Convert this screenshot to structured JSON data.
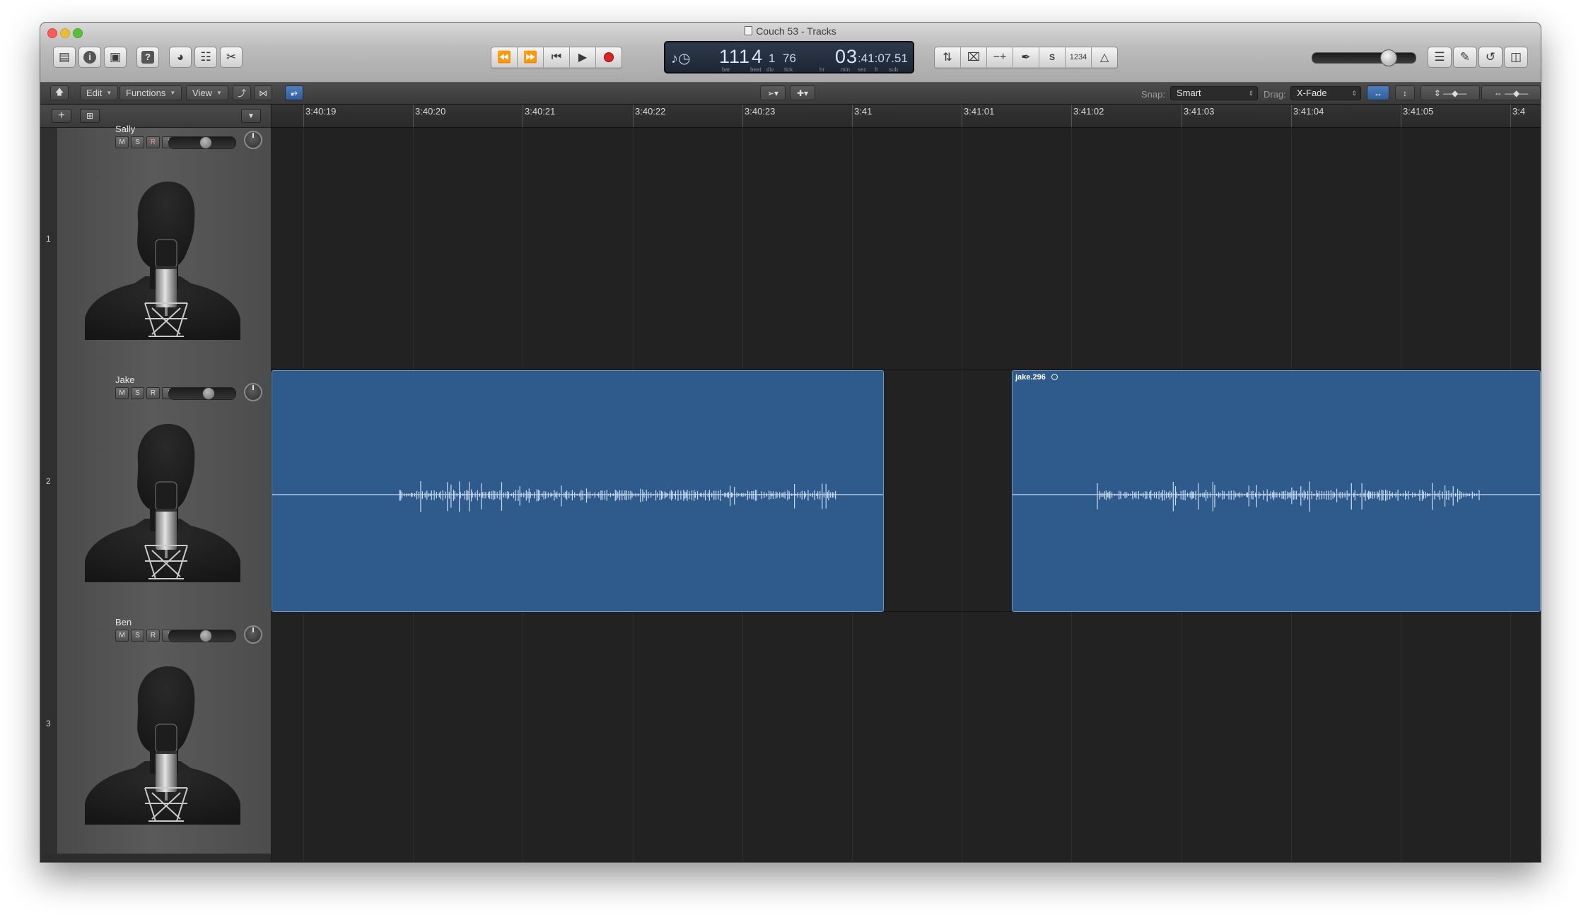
{
  "window": {
    "title": "Couch 53 - Tracks"
  },
  "lcd": {
    "bar": "111",
    "beat": "4",
    "div": "1",
    "tick": "76",
    "time_hr": "03",
    "time_rest": ":41:07.51",
    "labels": [
      "bar",
      "beat",
      "div",
      "tick",
      "hr",
      "min",
      "sec",
      "fr",
      "sub"
    ]
  },
  "toolbar": {
    "catch_label": "1234"
  },
  "control_bar": {
    "edit_label": "Edit",
    "functions_label": "Functions",
    "view_label": "View",
    "snap_label": "Snap:",
    "snap_value": "Smart",
    "drag_label": "Drag:",
    "drag_value": "X-Fade"
  },
  "ruler": {
    "labels": [
      "3:40:19",
      "3:40:20",
      "3:40:21",
      "3:40:22",
      "3:40:23",
      "3:41",
      "3:41:01",
      "3:41:02",
      "3:41:03",
      "3:41:04",
      "3:41:05",
      "3:4"
    ]
  },
  "tracks": [
    {
      "number": "1",
      "name": "Sally",
      "volume": 0.55
    },
    {
      "number": "2",
      "name": "Jake",
      "volume": 0.6
    },
    {
      "number": "3",
      "name": "Ben",
      "volume": 0.55
    }
  ],
  "msri_labels": {
    "mute": "M",
    "solo": "S",
    "record": "R",
    "input": "I"
  },
  "regions": [
    {
      "name": "",
      "track": 2
    },
    {
      "name": "jake.296",
      "track": 2
    }
  ],
  "colors": {
    "region_fill": "#2f5a8c",
    "region_border": "#6f97c7",
    "lane_bg": "#222222"
  },
  "icons": [
    "library-icon",
    "info-icon",
    "toolbar-icon",
    "help-icon",
    "smart-controls-icon",
    "mixer-icon",
    "editors-icon",
    "rewind-icon",
    "fast-forward-icon",
    "go-to-start-icon",
    "play-icon",
    "record-icon",
    "cycle-icon",
    "replace-icon",
    "autopunch-icon",
    "tuner-icon",
    "solo-icon",
    "count-in-icon",
    "metronome-icon",
    "list-editors-icon",
    "note-pad-icon",
    "loop-browser-icon",
    "browser-icon"
  ]
}
